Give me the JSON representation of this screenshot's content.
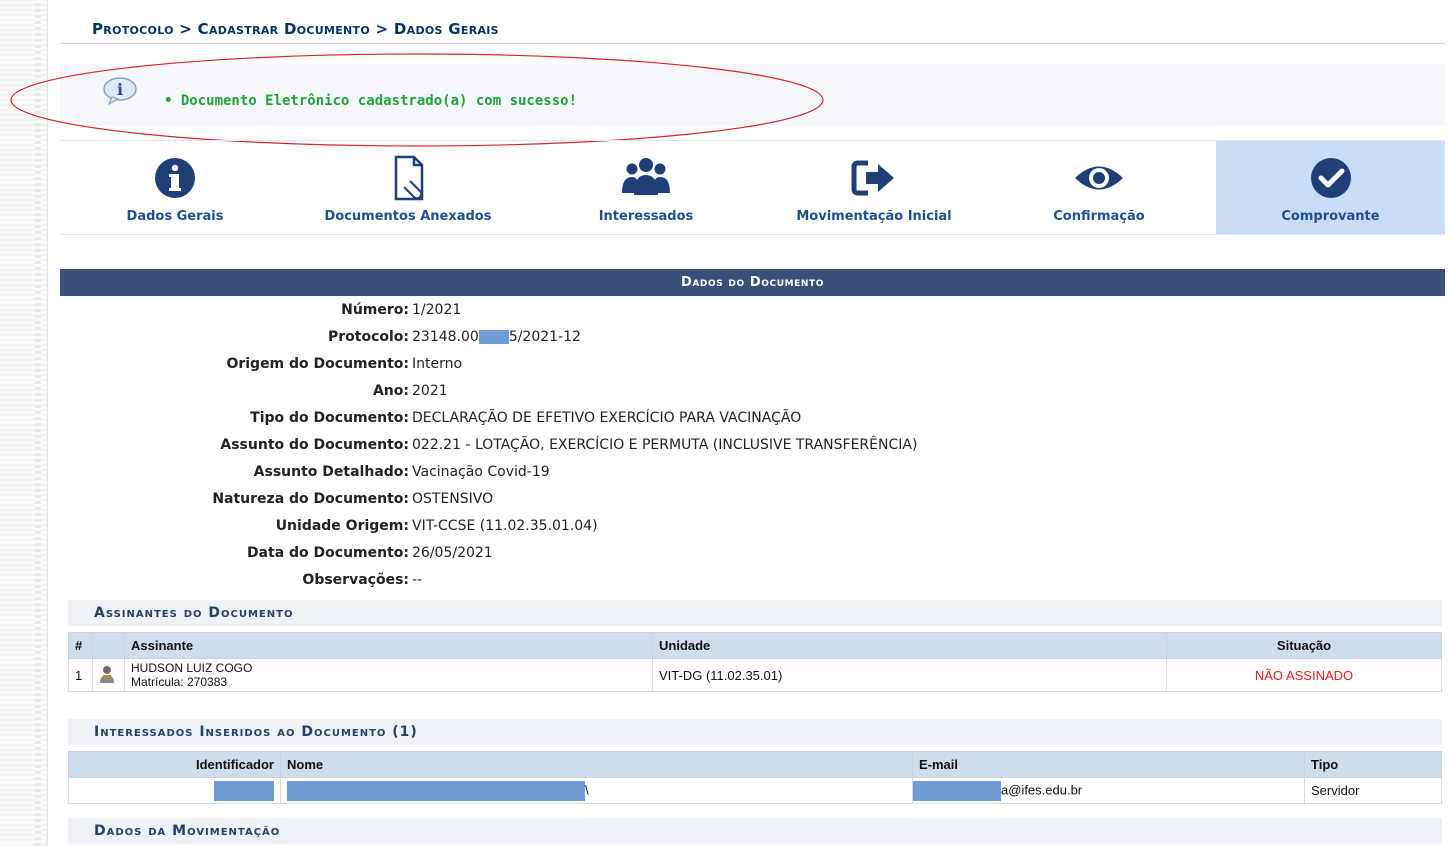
{
  "breadcrumb": {
    "text": "Protocolo > Cadastrar Documento > Dados Gerais"
  },
  "info": {
    "message": "• Documento Eletrônico cadastrado(a) com sucesso!"
  },
  "steps": [
    {
      "label": "Dados Gerais",
      "icon": "info-circle-icon"
    },
    {
      "label": "Documentos Anexados",
      "icon": "document-clip-icon"
    },
    {
      "label": "Interessados",
      "icon": "users-group-icon"
    },
    {
      "label": "Movimentação Inicial",
      "icon": "sign-out-arrow-icon"
    },
    {
      "label": "Confirmação",
      "icon": "eye-icon"
    },
    {
      "label": "Comprovante",
      "icon": "check-circle-icon",
      "active": true
    }
  ],
  "section_title": "Dados do Documento",
  "fields": [
    {
      "label": "Número:",
      "value": "1/2021"
    },
    {
      "label": "Protocolo:",
      "value_before": "23148.00",
      "value_after": "5/2021-12"
    },
    {
      "label": "Origem do Documento:",
      "value": "Interno"
    },
    {
      "label": "Ano:",
      "value": "2021"
    },
    {
      "label": "Tipo do Documento:",
      "value": "DECLARAÇÃO DE EFETIVO EXERCÍCIO PARA VACINAÇÃO"
    },
    {
      "label": "Assunto do Documento:",
      "value": "022.21 - LOTAÇÃO, EXERCÍCIO E PERMUTA (INCLUSIVE TRANSFERÊNCIA)"
    },
    {
      "label": "Assunto Detalhado:",
      "value": "Vacinação Covid-19"
    },
    {
      "label": "Natureza do Documento:",
      "value": "OSTENSIVO"
    },
    {
      "label": "Unidade Origem:",
      "value": "VIT-CCSE (11.02.35.01.04)"
    },
    {
      "label": "Data do Documento:",
      "value": "26/05/2021"
    },
    {
      "label": "Observações:",
      "value": "--"
    }
  ],
  "signers": {
    "title": "Assinantes do Documento",
    "headers": [
      "#",
      "",
      "Assinante",
      "Unidade",
      "Situação"
    ],
    "rows": [
      {
        "num": "1",
        "name": "HUDSON LUIZ COGO",
        "matricula": "Matrícula: 270383",
        "unit": "VIT-DG (11.02.35.01)",
        "status": "NÃO ASSINADO"
      }
    ]
  },
  "interested": {
    "title": "Interessados Inseridos ao Documento (1)",
    "headers": [
      "Identificador",
      "Nome",
      "E-mail",
      "Tipo"
    ],
    "rows": [
      {
        "name_tail": "\\",
        "email_tail": "a@ifes.edu.br",
        "tipo": "Servidor"
      }
    ]
  },
  "movement": {
    "title": "Dados da Movimentação"
  },
  "colors": {
    "header_bar": "#3b4f7b",
    "link_blue": "#1f4f8f",
    "success_green": "#22a33a",
    "status_red": "#e02020",
    "redaction": "#6f9dd8",
    "active_step": "#c9def6"
  }
}
